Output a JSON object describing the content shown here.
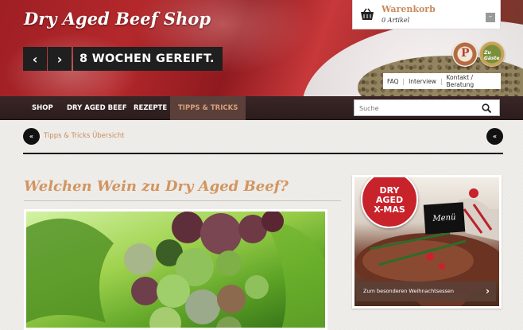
{
  "site": {
    "title": "Dry Aged Beef Shop"
  },
  "slider": {
    "prev_icon": "chevron-left-icon",
    "next_icon": "chevron-right-icon",
    "prev_glyph": "‹",
    "next_glyph": "›",
    "caption": "8 WOCHEN GEREIFT."
  },
  "cart": {
    "title": "Warenkorb",
    "count": "0 Artikel",
    "toggle": "–"
  },
  "badges": {
    "p": "P",
    "e": "Zu Gäste"
  },
  "service_links": [
    "FAQ",
    "Interview",
    "Kontakt / Beratung"
  ],
  "nav": {
    "items": [
      "SHOP",
      "DRY AGED BEEF",
      "REZEPTE",
      "TIPPS & TRICKS"
    ],
    "active_index": 3
  },
  "search": {
    "placeholder": "Suche",
    "value": ""
  },
  "breadcrumb": {
    "back_glyph": "«",
    "label": "Tipps & Tricks Übersicht",
    "forward_glyph": "«"
  },
  "article": {
    "title": "Welchen Wein zu Dry Aged Beef?"
  },
  "promo": {
    "badge_line1": "DRY",
    "badge_line2": "AGED",
    "badge_line3": "X-MAS",
    "menu_label": "Menü",
    "caption": "Zum besonderen Weihnachtsessen",
    "arrow": "›"
  },
  "colors": {
    "accent": "#d29560",
    "nav_bg": "#2c1c1c",
    "nav_active": "#5b3f3a",
    "badge_red": "#c8222b"
  }
}
